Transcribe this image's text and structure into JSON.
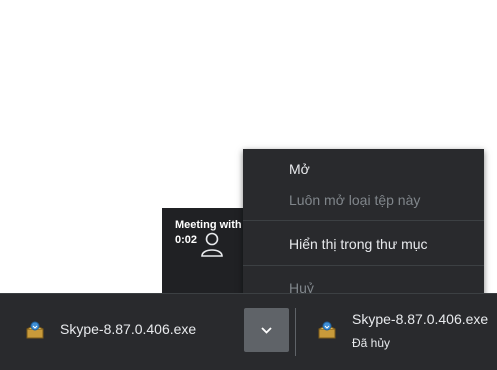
{
  "meeting": {
    "title": "Meeting with",
    "time": "0:02"
  },
  "menu": {
    "items": [
      {
        "label": "Mở",
        "enabled": true
      },
      {
        "label": "Luôn mở loại tệp này",
        "enabled": false
      },
      {
        "label": "Hiển thị trong thư mục",
        "enabled": true
      },
      {
        "label": "Huỷ",
        "enabled": false
      }
    ]
  },
  "shelf": {
    "downloads": [
      {
        "filename": "Skype-8.87.0.406.exe",
        "status": "",
        "icon": "installer-icon"
      },
      {
        "filename": "Skype-8.87.0.406.exe",
        "status": "Đã hủy",
        "icon": "installer-icon"
      }
    ],
    "menu_button_icon": "chevron-down-icon"
  },
  "colors": {
    "menu_bg": "#292a2d",
    "text": "#e8eaed",
    "disabled_text": "#80868b",
    "button_bg": "#5f6368"
  }
}
